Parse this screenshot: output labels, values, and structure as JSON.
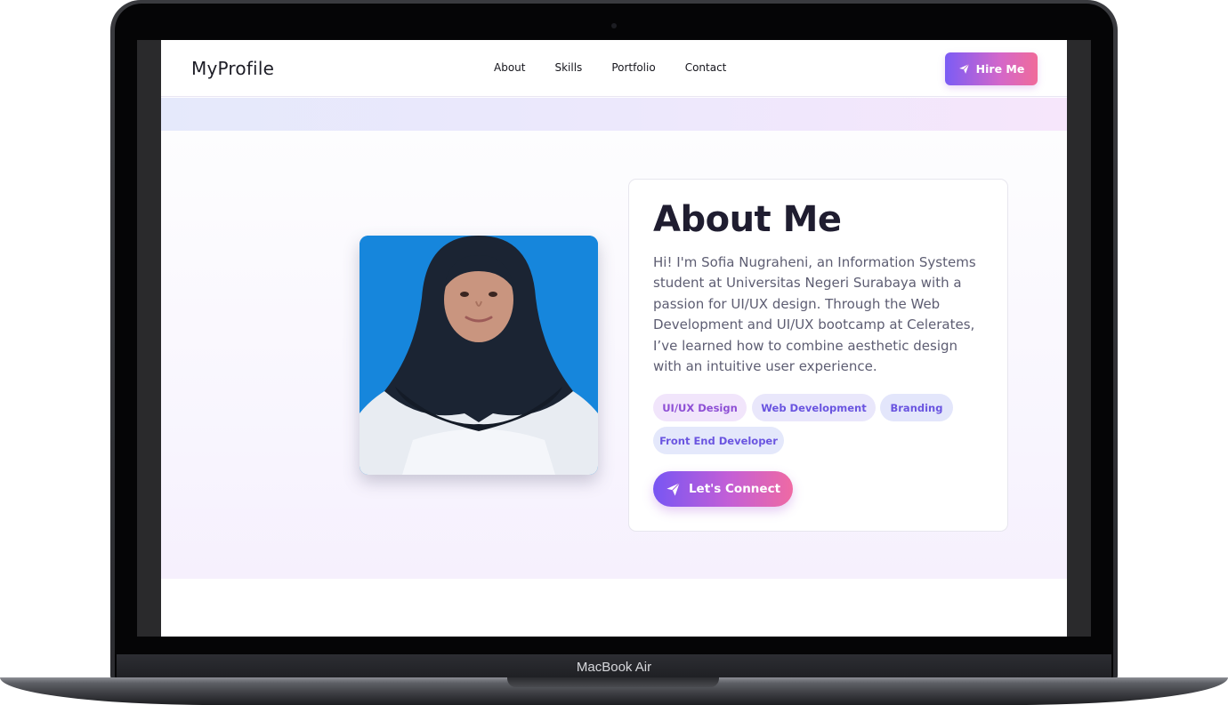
{
  "device": {
    "label": "MacBook Air"
  },
  "site": {
    "logo": "MyProfile",
    "nav": [
      {
        "label": "About"
      },
      {
        "label": "Skills"
      },
      {
        "label": "Portfolio"
      },
      {
        "label": "Contact"
      }
    ],
    "hire_button": {
      "label": "Hire Me",
      "icon": "paper-plane-icon"
    }
  },
  "about": {
    "title": "About Me",
    "description": "Hi! I'm Sofia Nugraheni, an Information Systems student at Universitas Negeri Surabaya with a passion for UI/UX design. Through the Web Development and UI/UX bootcamp at Celerates, I’ve learned how to combine aesthetic design with an intuitive user experience.",
    "tags": [
      "UI/UX Design",
      "Web Development",
      "Branding",
      "Front End Developer"
    ],
    "connect_button": {
      "label": "Let's Connect",
      "icon": "paper-plane-icon"
    }
  },
  "colors": {
    "accent_start": "#7b5cf5",
    "accent_end": "#f06b9a",
    "photo_background": "#1787dd"
  }
}
